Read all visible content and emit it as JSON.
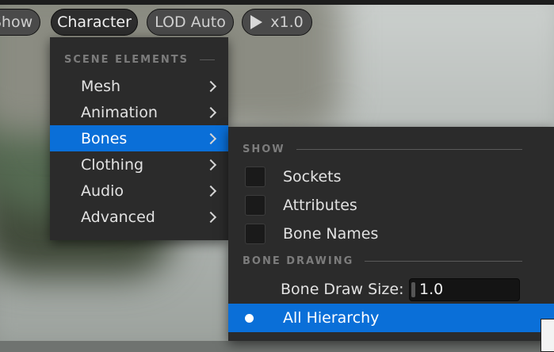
{
  "toolbar": {
    "show_label": "Show",
    "character_label": "Character",
    "lod_label": "LOD Auto",
    "speed_label": "x1.0"
  },
  "main_menu": {
    "section_title": "SCENE ELEMENTS",
    "items": [
      {
        "label": "Mesh"
      },
      {
        "label": "Animation"
      },
      {
        "label": "Bones"
      },
      {
        "label": "Clothing"
      },
      {
        "label": "Audio"
      },
      {
        "label": "Advanced"
      }
    ],
    "selected_item": "Bones"
  },
  "bones_submenu": {
    "show_section_title": "SHOW",
    "checkboxes": [
      {
        "label": "Sockets",
        "checked": false
      },
      {
        "label": "Attributes",
        "checked": false
      },
      {
        "label": "Bone Names",
        "checked": false
      }
    ],
    "drawing_section_title": "BONE DRAWING",
    "draw_size_label": "Bone Draw Size:",
    "draw_size_value": "1.0",
    "options": [
      {
        "label": "All Hierarchy",
        "selected": true
      }
    ]
  },
  "colors": {
    "selection": "#0a6fd8",
    "menu_bg": "#2b2b2b"
  }
}
